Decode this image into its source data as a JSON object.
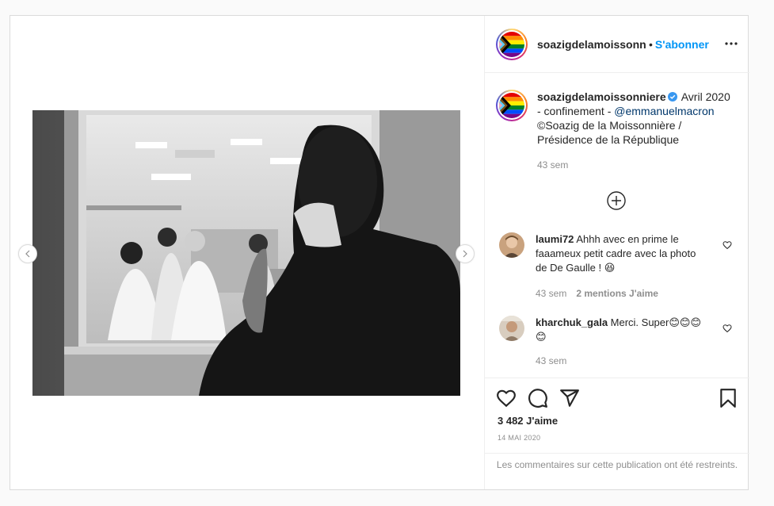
{
  "post": {
    "author": "soazigdelamoissonniere",
    "follow_label": "S'abonner",
    "dot": "•"
  },
  "caption": {
    "username": "soazigdelamoissonniere",
    "text_before_mention": " Avril 2020 - confinement - ",
    "mention": "@emmanuelmacron",
    "text_after_mention": " ©Soazig de la Moissonnière / Présidence de la République",
    "time": "43 sem"
  },
  "comments": [
    {
      "username": "laumi72",
      "text": " Ahhh avec en prime le faaameux petit cadre avec la photo de De Gaulle ! 😆",
      "time": "43 sem",
      "likes": "2 mentions J'aime"
    },
    {
      "username": "kharchuk_gala",
      "text": " Merci. Super😊😊😊😊",
      "time": "43 sem"
    }
  ],
  "footer": {
    "like_count": "3 482 J'aime",
    "date": "14 MAI 2020",
    "restricted_notice": "Les commentaires sur cette publication ont été restreints."
  },
  "icons": {
    "like": "heart-icon",
    "comment": "comment-icon",
    "share": "share-icon",
    "save": "bookmark-icon",
    "more": "more-icon",
    "load_more": "plus-circle-icon",
    "verified": "verified-badge-icon"
  },
  "colors": {
    "accent": "#0095f6",
    "mention": "#00376b",
    "secondary_text": "#8e8e8e",
    "border": "#dbdbdb",
    "verified": "#3897f0"
  }
}
